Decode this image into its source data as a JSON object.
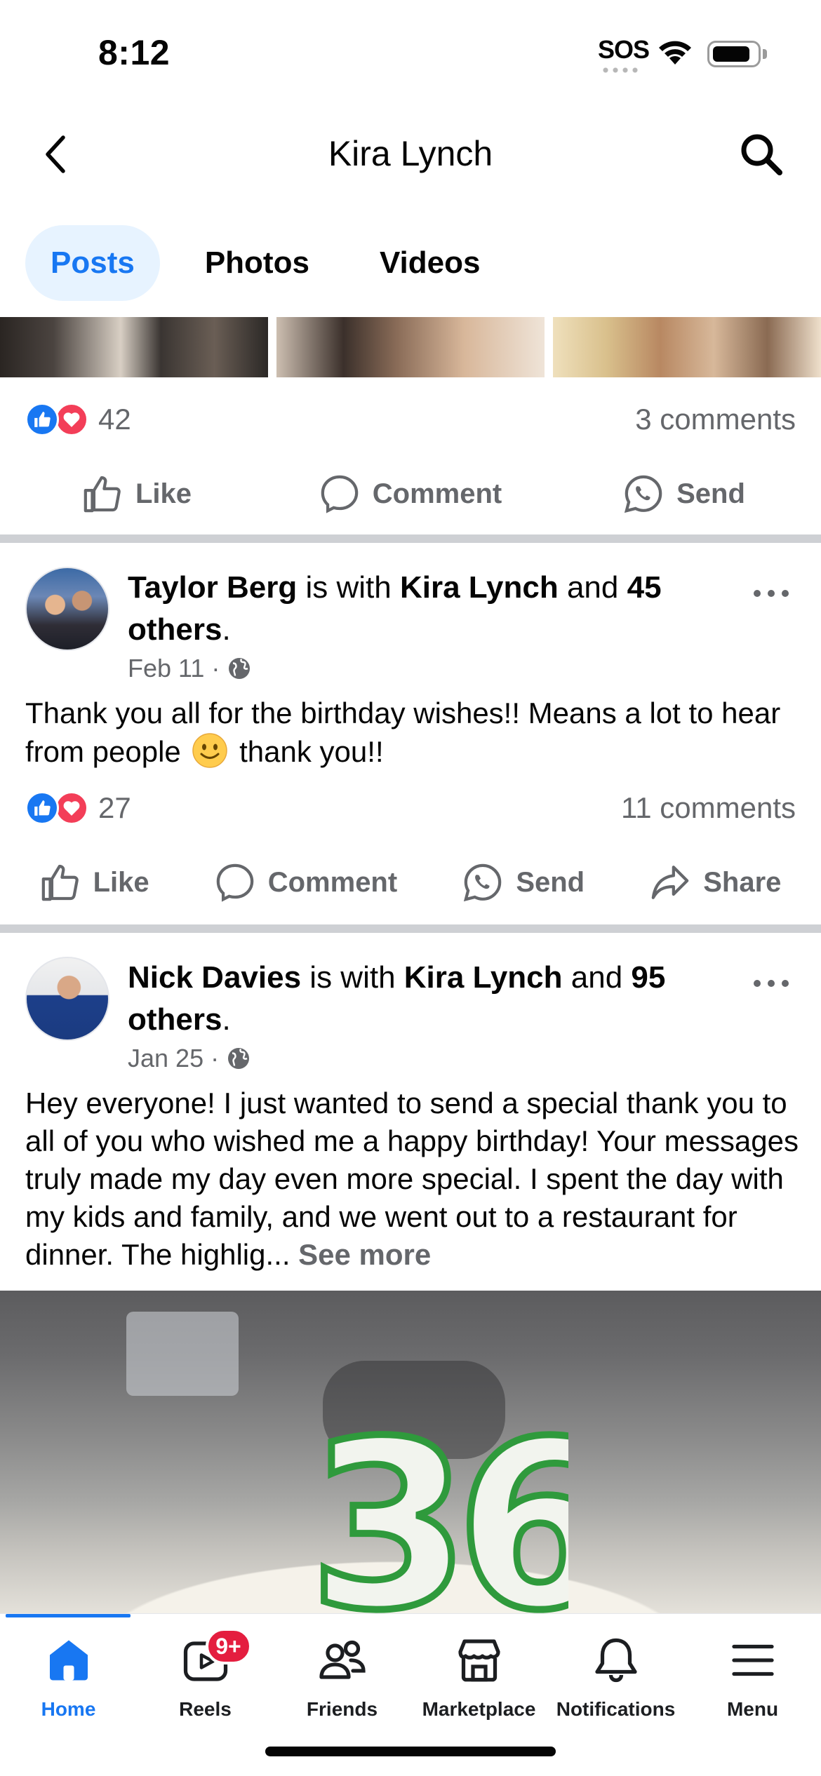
{
  "status_bar": {
    "time": "8:12",
    "sos": "SOS"
  },
  "header": {
    "title": "Kira Lynch"
  },
  "tabs": [
    {
      "label": "Posts",
      "active": true
    },
    {
      "label": "Photos",
      "active": false
    },
    {
      "label": "Videos",
      "active": false
    }
  ],
  "post0": {
    "reactions_count": "42",
    "comments": "3 comments",
    "actions": {
      "like": "Like",
      "comment": "Comment",
      "send": "Send"
    }
  },
  "post1": {
    "author": "Taylor Berg",
    "with_text": " is with ",
    "tagged": "Kira Lynch",
    "and_text": " and ",
    "others": "45 others",
    "period": ".",
    "date": "Feb 11",
    "text_before_emoji": "Thank you all for the birthday wishes!! Means a lot to hear from people",
    "text_after_emoji": "thank you!!",
    "reactions_count": "27",
    "comments": "11 comments",
    "actions": {
      "like": "Like",
      "comment": "Comment",
      "send": "Send",
      "share": "Share"
    }
  },
  "post2": {
    "author": "Nick Davies",
    "with_text": " is with ",
    "tagged": "Kira Lynch",
    "and_text": " and ",
    "others": "95 others",
    "period": ".",
    "date": "Jan 25",
    "text": "Hey everyone! I just wanted to send a special thank you to all of you who wished me a happy birthday! Your messages truly made my day even more special. I spent the day with my kids and family, and we went out to a restaurant for dinner. The highlig... ",
    "see_more": "See more",
    "image_candles": "36"
  },
  "tabbar": {
    "items": [
      {
        "label": "Home",
        "icon": "home-icon",
        "active": true
      },
      {
        "label": "Reels",
        "icon": "reels-icon",
        "badge": "9+"
      },
      {
        "label": "Friends",
        "icon": "friends-icon"
      },
      {
        "label": "Marketplace",
        "icon": "marketplace-icon"
      },
      {
        "label": "Notifications",
        "icon": "bell-icon"
      },
      {
        "label": "Menu",
        "icon": "menu-icon"
      }
    ]
  },
  "colors": {
    "accent": "#1877f2",
    "love": "#f33e58",
    "muted": "#65676b",
    "badge": "#e41e3f"
  }
}
